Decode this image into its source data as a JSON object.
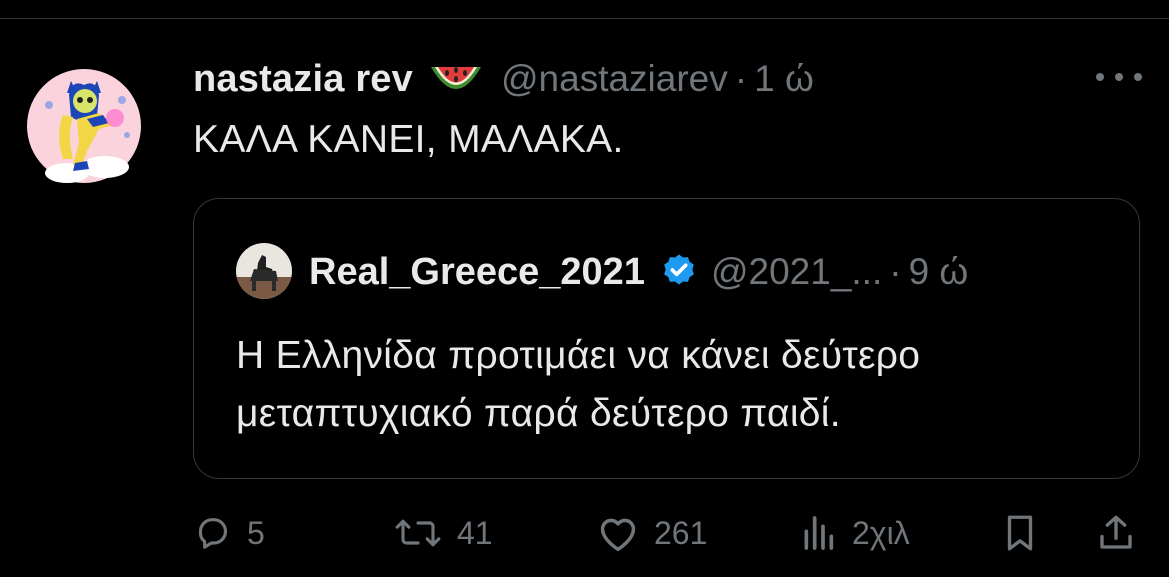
{
  "tweet": {
    "author_name": "nastazia rev",
    "author_emoji": "watermelon",
    "handle": "@nastaziarev",
    "separator": "·",
    "time": "1 ώ",
    "text": "ΚΑΛΑ ΚΑΝΕΙ, ΜΑΛΑΚΑ."
  },
  "quote": {
    "author_name": "Real_Greece_2021",
    "verified": true,
    "handle": "@2021_...",
    "separator": "·",
    "time": "9 ώ",
    "text": "Η Ελληνίδα προτιμάει να κάνει δεύτερο μεταπτυχιακό παρά δεύτερο παιδί."
  },
  "actions": {
    "replies": "5",
    "reposts": "41",
    "likes": "261",
    "views": "2χιλ"
  },
  "icons": [
    "more-icon",
    "verified-icon",
    "reply-icon",
    "repost-icon",
    "like-icon",
    "views-icon",
    "bookmark-icon",
    "share-icon"
  ],
  "colors": {
    "background": "#000000",
    "text": "#e7e9ea",
    "muted": "#71767b",
    "border": "#333639",
    "verified": "#1d9bf0"
  }
}
